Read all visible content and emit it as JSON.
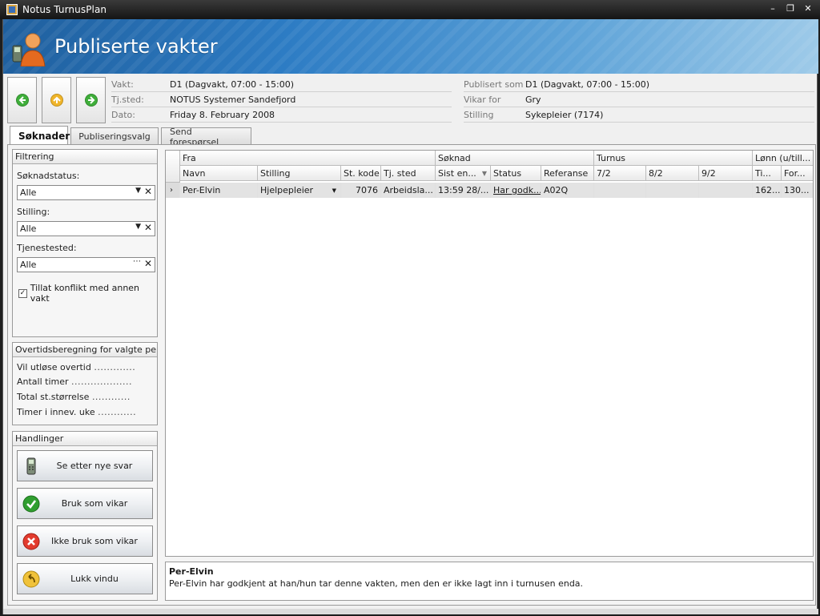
{
  "window": {
    "title": "Notus TurnusPlan"
  },
  "header": {
    "title": "Publiserte vakter"
  },
  "info_left": [
    {
      "label": "Vakt:",
      "value": "D1 (Dagvakt, 07:00 - 15:00)"
    },
    {
      "label": "Tj.sted:",
      "value": "NOTUS Systemer Sandefjord"
    },
    {
      "label": "Dato:",
      "value": "Friday 8. February 2008"
    }
  ],
  "info_right": [
    {
      "label": "Publisert som",
      "value": "D1 (Dagvakt, 07:00 - 15:00)"
    },
    {
      "label": "Vikar for",
      "value": "Gry"
    },
    {
      "label": "Stilling",
      "value": "Sykepleier (7174)"
    }
  ],
  "tabs": [
    {
      "label": "Søknader",
      "active": true
    },
    {
      "label": "Publiseringsvalg",
      "active": false
    },
    {
      "label": "Send forespørsel",
      "active": false
    }
  ],
  "filter": {
    "title": "Filtrering",
    "soknadstatus_label": "Søknadstatus:",
    "soknadstatus_value": "Alle",
    "stilling_label": "Stilling:",
    "stilling_value": "Alle",
    "tjenestested_label": "Tjenestested:",
    "tjenestested_value": "Alle",
    "conflict_label": "Tillat konflikt med annen vakt",
    "conflict_checked": true
  },
  "overtime": {
    "title": "Overtidsberegning for valgte person",
    "rows": [
      {
        "label": "Vil utløse overtid",
        "dots": "............."
      },
      {
        "label": "Antall timer",
        "dots": "..................."
      },
      {
        "label": "Total st.størrelse",
        "dots": "............"
      },
      {
        "label": "Timer i innev. uke",
        "dots": "............"
      }
    ]
  },
  "actions": {
    "title": "Handlinger",
    "buttons": [
      {
        "label": "Se etter nye svar",
        "icon": "phone-icon"
      },
      {
        "label": "Bruk som vikar",
        "icon": "check-icon"
      },
      {
        "label": "Ikke bruk som vikar",
        "icon": "cancel-icon"
      },
      {
        "label": "Lukk vindu",
        "icon": "undo-icon"
      }
    ]
  },
  "grid": {
    "groups": {
      "fra": "Fra",
      "soknad": "Søknad",
      "turnus": "Turnus",
      "lonn": "Lønn (u/till..."
    },
    "columns": {
      "navn": "Navn",
      "stilling": "Stilling",
      "st_kode": "St. kode",
      "tj_sted": "Tj. sted",
      "sist_en": "Sist en...",
      "status": "Status",
      "referanse": "Referanse",
      "d72": "7/2",
      "d82": "8/2",
      "d92": "9/2",
      "ti": "Ti...",
      "for": "For..."
    },
    "row": {
      "navn": "Per-Elvin",
      "stilling": "Hjelpepleier",
      "st_kode": "7076",
      "tj_sted": "Arbeidsla...",
      "sist_en": "13:59 28/...",
      "status": "Har godk...",
      "referanse": "A02Q",
      "d72": "",
      "d82": "",
      "d92": "",
      "ti": "162...",
      "for": "130..."
    }
  },
  "detail": {
    "name": "Per-Elvin",
    "message": "Per-Elvin    har godkjent at han/hun tar denne vakten, men den er ikke lagt inn i turnusen enda."
  },
  "colors": {
    "header_start": "#1f5f9e",
    "header_end": "#9fcbe9",
    "row_selected": "#e3e3e3"
  }
}
